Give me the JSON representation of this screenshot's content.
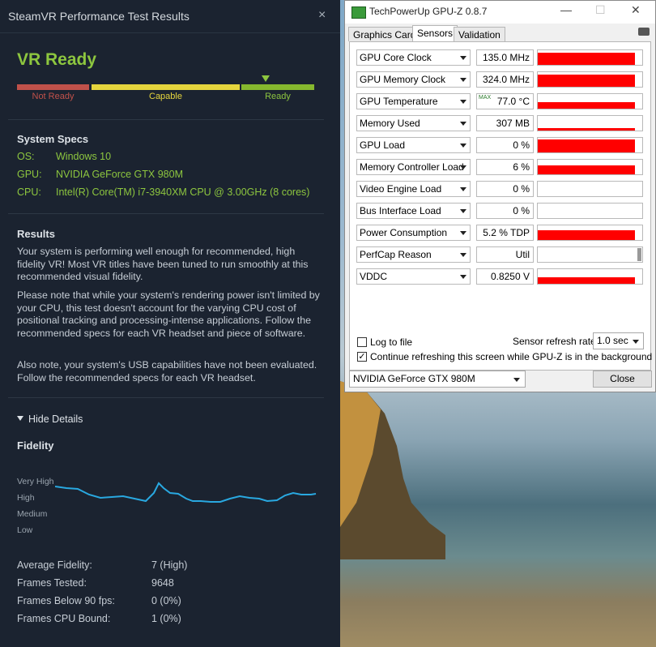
{
  "steamvr": {
    "window_title": "SteamVR Performance Test Results",
    "close_glyph": "×",
    "status": "VR Ready",
    "scale": {
      "not_ready": "Not Ready",
      "capable": "Capable",
      "ready": "Ready"
    },
    "system_specs": {
      "heading": "System Specs",
      "os_label": "OS:",
      "os_value": "Windows 10",
      "gpu_label": "GPU:",
      "gpu_value": "NVIDIA GeForce GTX 980M",
      "cpu_label": "CPU:",
      "cpu_value": "Intel(R) Core(TM) i7-3940XM CPU @ 3.00GHz (8 cores)"
    },
    "results": {
      "heading": "Results",
      "p1": "Your system is performing well enough for recommended, high fidelity VR! Most VR titles have been tuned to run smoothly at this recommended visual fidelity.",
      "p2": "Please note that while your system's rendering power isn't limited by your CPU, this test doesn't account for the varying CPU cost of positional tracking and processing-intense applications. Follow the recommended specs for each VR headset and piece of software.",
      "p3": "Also note, your system's USB capabilities have not been evaluated. Follow the recommended specs for each VR headset."
    },
    "hide_details": "Hide Details",
    "fidelity": {
      "heading": "Fidelity",
      "levels": [
        "Very High",
        "High",
        "Medium",
        "Low"
      ],
      "line_color": "#29a8e0"
    },
    "stats": {
      "avg_label": "Average Fidelity:",
      "avg_value": "7 (High)",
      "frames_label": "Frames Tested:",
      "frames_value": "9648",
      "below_label": "Frames Below 90 fps:",
      "below_value": "0 (0%)",
      "cpu_label": "Frames CPU Bound:",
      "cpu_value": "1 (0%)"
    },
    "colors": {
      "ready_green": "#8dc63f",
      "not_ready_red": "#c0514a",
      "capable_yellow": "#e5d53d"
    }
  },
  "gpuz": {
    "window_title": "TechPowerUp GPU-Z 0.8.7",
    "tabs": [
      "Graphics Card",
      "Sensors",
      "Validation"
    ],
    "active_tab": "Sensors",
    "max_tag": "MAX",
    "sensors": [
      {
        "name": "GPU Core Clock",
        "value": "135.0 MHz",
        "level": 0.85
      },
      {
        "name": "GPU Memory Clock",
        "value": "324.0 MHz",
        "level": 0.85
      },
      {
        "name": "GPU Temperature",
        "value": "77.0 °C",
        "level": 0.45
      },
      {
        "name": "Memory Used",
        "value": "307 MB",
        "level": 0.15
      },
      {
        "name": "GPU Load",
        "value": "0 %",
        "level": 0.9
      },
      {
        "name": "Memory Controller Load",
        "value": "6 %",
        "level": 0.6
      },
      {
        "name": "Video Engine Load",
        "value": "0 %",
        "level": 0
      },
      {
        "name": "Bus Interface Load",
        "value": "0 %",
        "level": 0
      },
      {
        "name": "Power Consumption",
        "value": "5.2 % TDP",
        "level": 0.65
      },
      {
        "name": "PerfCap Reason",
        "value": "Util",
        "level": 0
      },
      {
        "name": "VDDC",
        "value": "0.8250 V",
        "level": 0.45
      }
    ],
    "log_to_file": "Log to file",
    "refresh_label": "Sensor refresh rate:",
    "refresh_value": "1.0 sec",
    "continue_label": "Continue refreshing this screen while GPU-Z is in the background",
    "gpu_select": "NVIDIA GeForce GTX 980M",
    "close_button": "Close",
    "graph_color": "#ff0000"
  }
}
